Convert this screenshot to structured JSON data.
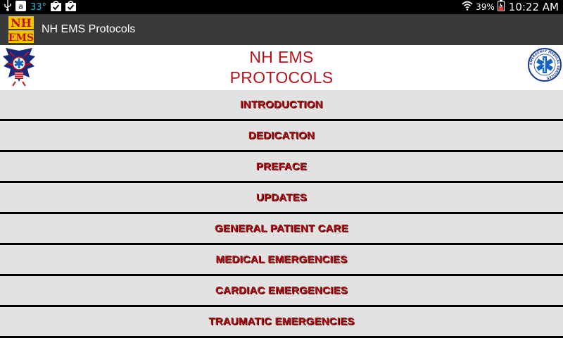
{
  "status_bar": {
    "temperature": "33°",
    "battery": "39%",
    "time": "10:22 AM",
    "icons": [
      "usb-icon",
      "amazon-icon",
      "bag-check-icon",
      "bag-check-icon",
      "wifi-icon",
      "battery-icon"
    ],
    "temp_color": "#33b5e5"
  },
  "action_bar": {
    "app_icon_text": [
      "NH",
      "EMS"
    ],
    "title": "NH EMS Protocols"
  },
  "header": {
    "title_line1": "NH EMS",
    "title_line2": "PROTOCOLS",
    "title_color": "#b8111a",
    "right_logo_text": "EMERGENCY MEDICAL SERVICES"
  },
  "menu": {
    "items": [
      {
        "label": "INTRODUCTION"
      },
      {
        "label": "DEDICATION"
      },
      {
        "label": "PREFACE"
      },
      {
        "label": "UPDATES"
      },
      {
        "label": "GENERAL PATIENT CARE"
      },
      {
        "label": "MEDICAL EMERGENCIES"
      },
      {
        "label": "CARDIAC EMERGENCIES"
      },
      {
        "label": "TRAUMATIC EMERGENCIES"
      }
    ]
  }
}
